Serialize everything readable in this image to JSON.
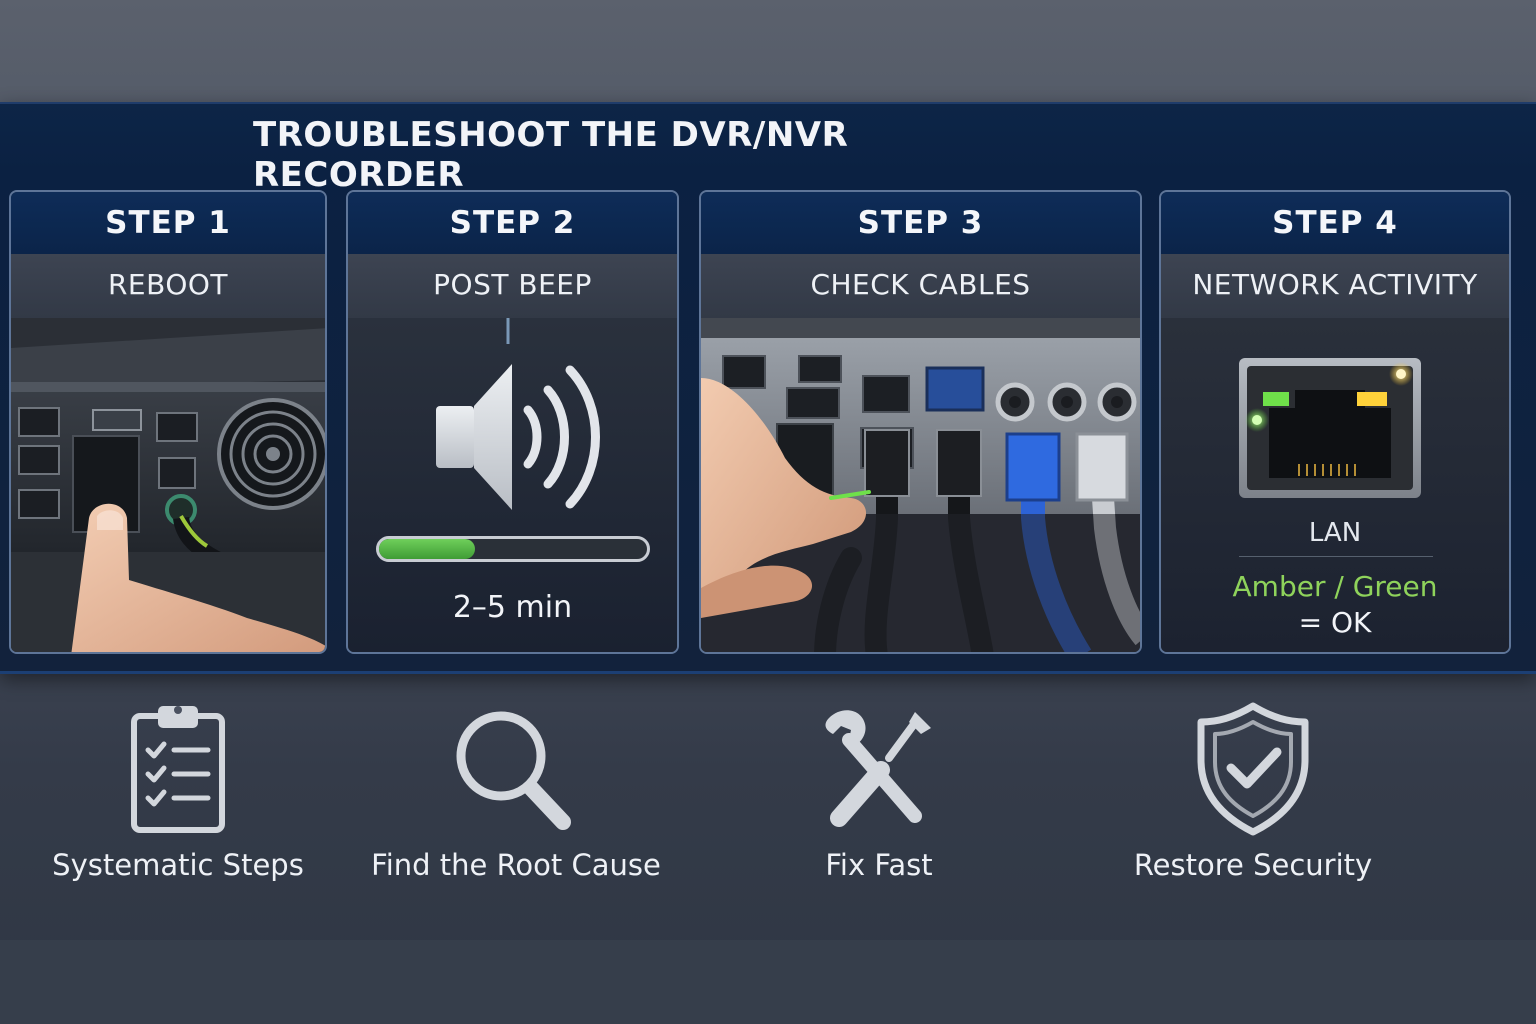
{
  "title": "TROUBLESHOOT THE DVR/NVR RECORDER",
  "steps": [
    {
      "step": "STEP 1",
      "label": "REBOOT"
    },
    {
      "step": "STEP 2",
      "label": "POST BEEP",
      "progress": 0.36,
      "duration": "2–5 min"
    },
    {
      "step": "STEP 3",
      "label": "CHECK CABLES"
    },
    {
      "step": "STEP 4",
      "label": "NETWORK ACTIVITY",
      "port_label": "LAN",
      "status": "Amber / Green",
      "status_ok": "= OK"
    }
  ],
  "features": [
    {
      "label": "Systematic Steps",
      "icon": "clipboard-checklist-icon"
    },
    {
      "label": "Find the Root Cause",
      "icon": "magnifier-icon"
    },
    {
      "label": "Fix Fast",
      "icon": "wrench-screwdriver-icon"
    },
    {
      "label": "Restore Security",
      "icon": "shield-check-icon"
    }
  ],
  "colors": {
    "header_navy": "#0b2449",
    "led_green": "#6fe04a",
    "led_amber": "#ffd23a",
    "progress_green": "#4fb23f",
    "cable_blue": "#2d63d6"
  }
}
